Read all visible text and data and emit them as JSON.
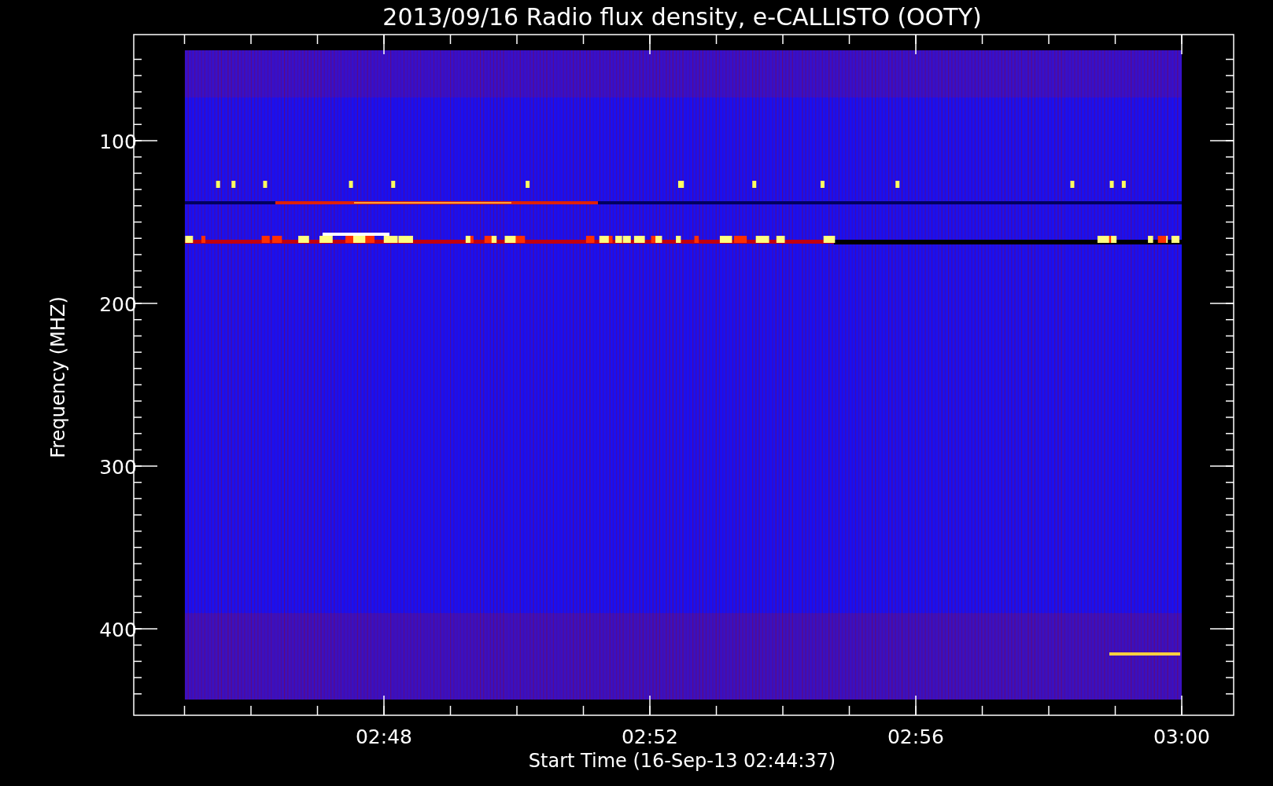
{
  "title": "2013/09/16  Radio flux density, e-CALLISTO (OOTY)",
  "y_axis": {
    "label": "Frequency (MHZ)",
    "ticks": [
      "100",
      "200",
      "300",
      "400"
    ]
  },
  "x_axis": {
    "label": "Start Time (16-Sep-13 02:44:37)",
    "ticks": [
      "02:48",
      "02:52",
      "02:56",
      "03:00"
    ]
  }
}
